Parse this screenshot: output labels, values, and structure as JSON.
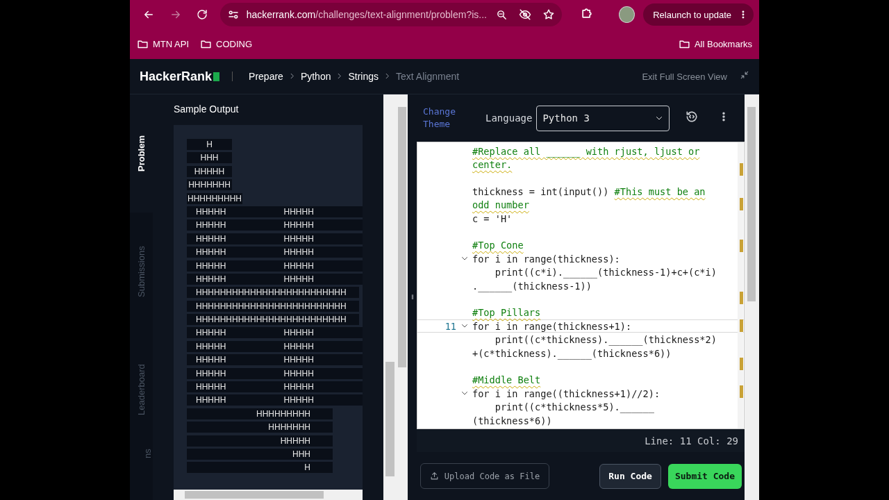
{
  "browser": {
    "url_host": "hackerrank.com",
    "url_path": "/challenges/text-alignment/problem?is...",
    "relaunch": "Relaunch to update",
    "bookmarks": [
      {
        "label": "MTN API"
      },
      {
        "label": "CODING"
      }
    ],
    "all_bookmarks": "All Bookmarks"
  },
  "header": {
    "logo": "HackerRank",
    "breadcrumbs": [
      {
        "label": "Prepare",
        "current": false
      },
      {
        "label": "Python",
        "current": false
      },
      {
        "label": "Strings",
        "current": false
      },
      {
        "label": "Text Alignment",
        "current": true
      }
    ],
    "exit": "Exit Full Screen View"
  },
  "side_tabs": [
    {
      "label": "Problem",
      "selected": true
    },
    {
      "label": "Submissions",
      "selected": false
    },
    {
      "label": "Leaderboard",
      "selected": false
    },
    {
      "label": "ns",
      "selected": false
    }
  ],
  "sample_output": {
    "title": "Sample Output",
    "rows": [
      {
        "kind": "top",
        "cells": [
          "H"
        ]
      },
      {
        "kind": "top",
        "cells": [
          "HHH"
        ]
      },
      {
        "kind": "top",
        "cells": [
          "HHHHH"
        ]
      },
      {
        "kind": "top",
        "cells": [
          "HHHHHHH"
        ]
      },
      {
        "kind": "top",
        "cells": [
          "HHHHHHHHH"
        ]
      },
      {
        "kind": "pillar",
        "cells": [
          "HHHHH",
          "HHHHH"
        ]
      },
      {
        "kind": "pillar",
        "cells": [
          "HHHHH",
          "HHHHH"
        ]
      },
      {
        "kind": "pillar",
        "cells": [
          "HHHHH",
          "HHHHH"
        ]
      },
      {
        "kind": "pillar",
        "cells": [
          "HHHHH",
          "HHHHH"
        ]
      },
      {
        "kind": "pillar",
        "cells": [
          "HHHHH",
          "HHHHH"
        ]
      },
      {
        "kind": "pillar",
        "cells": [
          "HHHHH",
          "HHHHH"
        ]
      },
      {
        "kind": "belt",
        "cells": [
          "HHHHHHHHHHHHHHHHHHHHHHHHH"
        ]
      },
      {
        "kind": "belt",
        "cells": [
          "HHHHHHHHHHHHHHHHHHHHHHHHH"
        ]
      },
      {
        "kind": "belt",
        "cells": [
          "HHHHHHHHHHHHHHHHHHHHHHHHH"
        ]
      },
      {
        "kind": "pillar",
        "cells": [
          "HHHHH",
          "HHHHH"
        ]
      },
      {
        "kind": "pillar",
        "cells": [
          "HHHHH",
          "HHHHH"
        ]
      },
      {
        "kind": "pillar",
        "cells": [
          "HHHHH",
          "HHHHH"
        ]
      },
      {
        "kind": "pillar",
        "cells": [
          "HHHHH",
          "HHHHH"
        ]
      },
      {
        "kind": "pillar",
        "cells": [
          "HHHHH",
          "HHHHH"
        ]
      },
      {
        "kind": "pillar",
        "cells": [
          "HHHHH",
          "HHHHH"
        ]
      },
      {
        "kind": "bottom",
        "cells": [
          "HHHHHHHHH"
        ]
      },
      {
        "kind": "bottom",
        "cells": [
          "HHHHHHH"
        ]
      },
      {
        "kind": "bottom",
        "cells": [
          "HHHHH"
        ]
      },
      {
        "kind": "bottom",
        "cells": [
          "HHH"
        ]
      },
      {
        "kind": "bottom",
        "cells": [
          "H"
        ]
      }
    ]
  },
  "editor": {
    "change_theme": "Change Theme",
    "language_label": "Language",
    "language": "Python 3",
    "lines": [
      {
        "kind": "comment",
        "text": "#Replace all ______ with rjust, ljust or",
        "fold": false
      },
      {
        "kind": "comment",
        "text": "center.",
        "fold": false
      },
      {
        "kind": "blank"
      },
      {
        "kind": "code",
        "text": "thickness = int(input()) ",
        "comment": "#This must be an",
        "fold": false
      },
      {
        "kind": "comment",
        "text": "odd number",
        "fold": false
      },
      {
        "kind": "code",
        "text": "c = 'H'",
        "fold": false
      },
      {
        "kind": "blank"
      },
      {
        "kind": "comment",
        "text": "#Top Cone",
        "fold": false
      },
      {
        "kind": "code",
        "text": "for i in range(thickness):",
        "fold": true
      },
      {
        "kind": "code",
        "text": "    print((c*i).______(thickness-1)+c+(c*i)",
        "fold": false
      },
      {
        "kind": "code",
        "text": ".______(thickness-1))",
        "fold": false
      },
      {
        "kind": "blank"
      },
      {
        "kind": "comment",
        "text": "#Top Pillars",
        "fold": false
      },
      {
        "kind": "code",
        "text": "for i in range(thickness+1):",
        "fold": true,
        "number": "11",
        "current": true
      },
      {
        "kind": "code",
        "text": "    print((c*thickness).______(thickness*2)",
        "fold": false
      },
      {
        "kind": "code",
        "text": "+(c*thickness).______(thickness*6))",
        "fold": false
      },
      {
        "kind": "blank"
      },
      {
        "kind": "comment",
        "text": "#Middle Belt",
        "fold": false
      },
      {
        "kind": "code",
        "text": "for i in range((thickness+1)//2):",
        "fold": true
      },
      {
        "kind": "code",
        "text": "    print((c*thickness*5).______",
        "fold": false
      },
      {
        "kind": "code",
        "text": "(thickness*6))",
        "fold": false
      }
    ],
    "status": "Line: 11 Col: 29"
  },
  "buttons": {
    "upload": "Upload Code as File",
    "run": "Run Code",
    "submit": "Submit Code"
  }
}
